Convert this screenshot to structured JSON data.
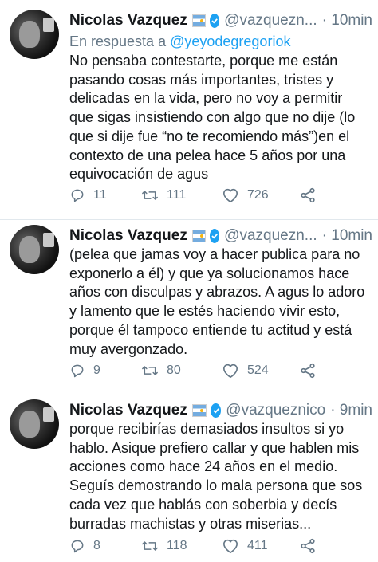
{
  "tweets": [
    {
      "name": "Nicolas Vazquez",
      "handle": "@vazquezn...",
      "time": "· 10min",
      "reply_prefix": "En respuesta a",
      "reply_mention": "@yeyodegregoriok",
      "text": "No pensaba contestarte, porque me están pasando cosas más importantes, tristes y delicadas en la vida, pero no voy a permitir que sigas insistiendo con algo que no dije (lo que si dije fue “no te recomiendo más”)en el contexto de una pelea hace 5 años por una equivocación de agus",
      "replies": "11",
      "retweets": "111",
      "likes": "726"
    },
    {
      "name": "Nicolas Vazquez",
      "handle": "@vazquezn...",
      "time": "· 10min",
      "text": "(pelea que jamas voy a hacer publica para no exponerlo a él) y que ya solucionamos hace años con disculpas y abrazos. A agus lo adoro y lamento que le estés haciendo vivir esto, porque él tampoco entiende tu actitud y está muy avergonzado.",
      "replies": "9",
      "retweets": "80",
      "likes": "524"
    },
    {
      "name": "Nicolas Vazquez",
      "handle": "@vazqueznico",
      "time": "· 9min",
      "text": "porque recibirías demasiados insultos si yo hablo. Asique prefiero callar y que hablen mis acciones como hace 24 años en el medio. Seguís demostrando lo mala persona que sos cada vez que hablás con soberbia y decís burradas machistas y otras miserias...",
      "replies": "8",
      "retweets": "118",
      "likes": "411"
    }
  ],
  "colors": {
    "accent": "#1da1f2",
    "muted": "#657786",
    "text": "#14171a"
  },
  "icons": [
    "reply-icon",
    "retweet-icon",
    "like-icon",
    "share-icon",
    "verified-badge-icon",
    "argentina-flag-icon"
  ]
}
